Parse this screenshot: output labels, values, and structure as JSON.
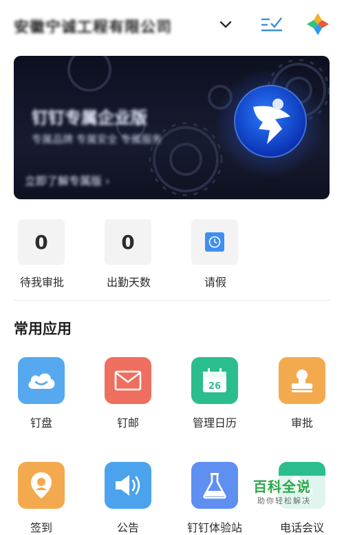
{
  "header": {
    "org_name": "安徽宁诚工程有限公司",
    "icons": [
      "chevron-down-icon",
      "task-list-icon",
      "dingtalk-logo-icon"
    ]
  },
  "banner": {
    "title": "钉钉专属企业版",
    "subtitle": "专属品牌 专属安全 专属服务",
    "cta": "立即了解专属版 ›",
    "emblem": "dingtalk-wing-emblem"
  },
  "stats": [
    {
      "value": "0",
      "label": "待我审批"
    },
    {
      "value": "0",
      "label": "出勤天数"
    },
    {
      "value": "",
      "label": "请假",
      "icon": "leave-clock-icon"
    }
  ],
  "section": {
    "title": "常用应用"
  },
  "apps": [
    {
      "label": "钉盘",
      "icon": "cloud-icon",
      "color": "#56a9ee"
    },
    {
      "label": "钉邮",
      "icon": "mail-icon",
      "color": "#ee6f5f"
    },
    {
      "label": "管理日历",
      "icon": "calendar-icon",
      "color": "#2bbd8e",
      "date": "26"
    },
    {
      "label": "审批",
      "icon": "stamp-icon",
      "color": "#f3aa4e"
    },
    {
      "label": "签到",
      "icon": "location-pin-icon",
      "color": "#f3aa4e"
    },
    {
      "label": "公告",
      "icon": "megaphone-icon",
      "color": "#4aa3ec"
    },
    {
      "label": "钉钉体验站",
      "icon": "flask-icon",
      "color": "#5f8ff0"
    },
    {
      "label": "电话会议",
      "icon": "phone-icon",
      "color": "#2bbd8e"
    }
  ],
  "watermark": {
    "main": "百科全说",
    "sub": "助你轻松解决"
  },
  "colors": {
    "accent": "#3a8ee6",
    "background": "#ffffff"
  }
}
